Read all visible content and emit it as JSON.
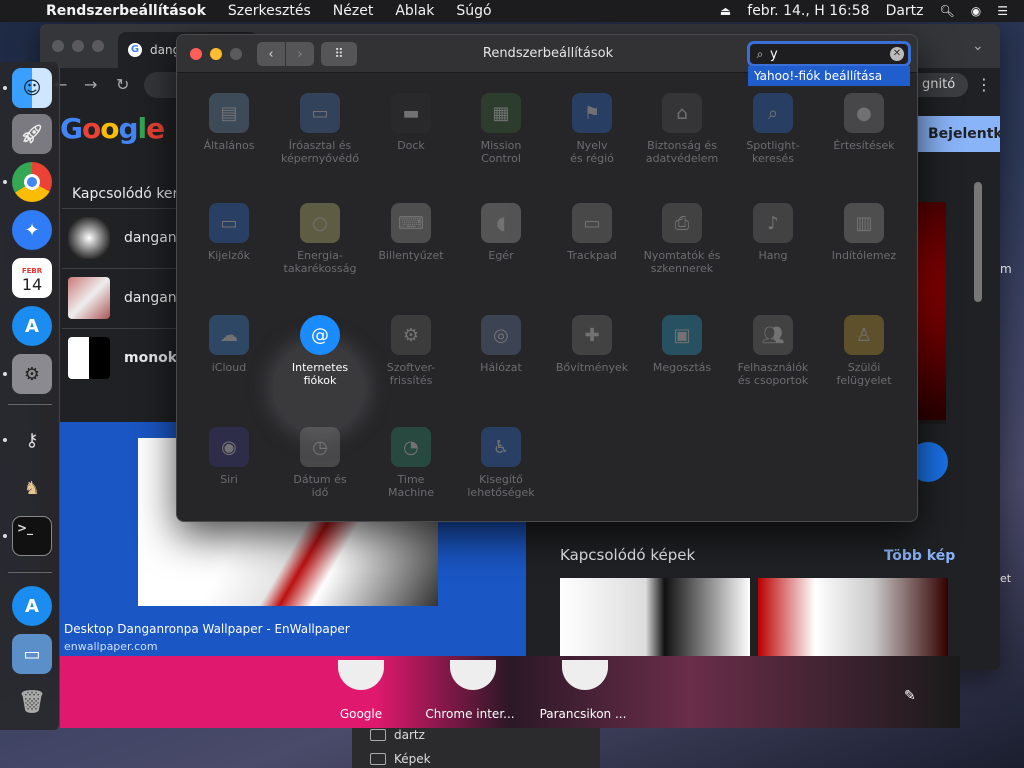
{
  "menubar": {
    "app_name": "Rendszerbeállítások",
    "menus": [
      "Szerkesztés",
      "Nézet",
      "Ablak",
      "Súgó"
    ],
    "datetime": "febr. 14., H  16:58",
    "user": "Dartz"
  },
  "chrome": {
    "tab_title": "dang",
    "incognito_label": "gnitó",
    "signin_label": "Bejelentk",
    "related_searches_title": "Kapcsolódó ker",
    "related_searches": [
      {
        "text": "danganr"
      },
      {
        "text": "danganr"
      },
      {
        "text": "monoku"
      }
    ],
    "result": {
      "title": "Desktop Danganronpa Wallpaper - EnWallpaper",
      "url": "enwallpaper.com"
    },
    "related_images_title": "Kapcsolódó képek",
    "more_images": "Több kép"
  },
  "new_tab_shortcuts": [
    {
      "label": "Google"
    },
    {
      "label": "Chrome inter..."
    },
    {
      "label": "Parancsikon ..."
    }
  ],
  "finder": {
    "rows": [
      {
        "label": "dartz"
      },
      {
        "label": "Képek"
      }
    ]
  },
  "edge_fragments": {
    "right_top": "m",
    "right_bottom": "et"
  },
  "dock": {
    "calendar_month": "FEBR",
    "calendar_day": "14"
  },
  "syspref": {
    "title": "Rendszerbeállítások",
    "search_value": "y",
    "suggestion": "Yahoo!-fiók beállítása",
    "panes": [
      {
        "label": "Általános",
        "icon": "general-icon"
      },
      {
        "label": "Íróasztal és\nképernyővédő",
        "icon": "desktop-icon"
      },
      {
        "label": "Dock",
        "icon": "dock-icon"
      },
      {
        "label": "Mission\nControl",
        "icon": "mission-control-icon"
      },
      {
        "label": "Nyelv\nés régió",
        "icon": "flag-icon"
      },
      {
        "label": "Biztonság és\nadatvédelem",
        "icon": "house-lock-icon"
      },
      {
        "label": "Spotlight-\nkeresés",
        "icon": "magnifier-icon"
      },
      {
        "label": "Értesítések",
        "icon": "notifications-icon"
      },
      {
        "label": "Kijelzők",
        "icon": "monitor-icon"
      },
      {
        "label": "Energia-\ntakarékosság",
        "icon": "bulb-icon"
      },
      {
        "label": "Billentyűzet",
        "icon": "keyboard-icon"
      },
      {
        "label": "Egér",
        "icon": "mouse-icon"
      },
      {
        "label": "Trackpad",
        "icon": "trackpad-icon"
      },
      {
        "label": "Nyomtatók és\nszkennerek",
        "icon": "printer-icon"
      },
      {
        "label": "Hang",
        "icon": "speaker-icon"
      },
      {
        "label": "Indítólemez",
        "icon": "disk-icon"
      },
      {
        "label": "iCloud",
        "icon": "cloud-icon"
      },
      {
        "label": "Internetes\nfiókok",
        "icon": "at-sign-icon"
      },
      {
        "label": "Szoftver-\nfrissítés",
        "icon": "gear-icon"
      },
      {
        "label": "Hálózat",
        "icon": "globe-icon"
      },
      {
        "label": "Bővítmények",
        "icon": "puzzle-icon"
      },
      {
        "label": "Megosztás",
        "icon": "sharing-folder-icon"
      },
      {
        "label": "Felhasználók\nés csoportok",
        "icon": "users-icon"
      },
      {
        "label": "Szülői\nfelügyelet",
        "icon": "parental-icon"
      },
      {
        "label": "Siri",
        "icon": "siri-icon"
      },
      {
        "label": "Dátum és\nidő",
        "icon": "clock-calendar-icon"
      },
      {
        "label": "Time\nMachine",
        "icon": "time-machine-icon"
      },
      {
        "label": "Kisegítő\nlehetőségek",
        "icon": "accessibility-icon"
      }
    ]
  },
  "colors": {
    "accent": "#3a6fd8",
    "close": "#ff5f57",
    "minimize": "#febc2e",
    "highlight_pane": "#1a8cff"
  }
}
